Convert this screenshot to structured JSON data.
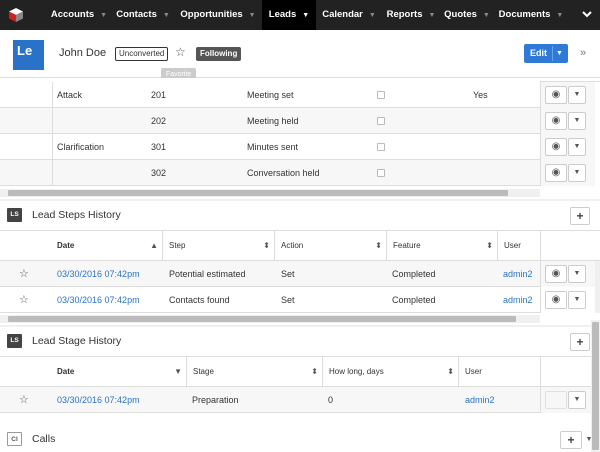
{
  "nav": {
    "items": [
      {
        "label": "Accounts"
      },
      {
        "label": "Contacts"
      },
      {
        "label": "Opportunities"
      },
      {
        "label": "Leads"
      },
      {
        "label": "Calendar"
      },
      {
        "label": "Reports"
      },
      {
        "label": "Quotes"
      },
      {
        "label": "Documents"
      }
    ],
    "active": "Leads",
    "more_icon": "chevron-down-icon"
  },
  "header": {
    "avatar_text": "Le",
    "name": "John Doe",
    "status_badge": "Unconverted",
    "following_badge": "Following",
    "tooltip": "Favorite",
    "edit_label": "Edit"
  },
  "top_table": {
    "rows": [
      {
        "col1": "Attack",
        "code": "201",
        "step": "Meeting set",
        "flag": "Yes"
      },
      {
        "col1": "",
        "code": "202",
        "step": "Meeting held",
        "flag": ""
      },
      {
        "col1": "Clarification",
        "code": "301",
        "step": "Minutes sent",
        "flag": ""
      },
      {
        "col1": "",
        "code": "302",
        "step": "Conversation held",
        "flag": ""
      }
    ]
  },
  "steps_history": {
    "icon": "LS",
    "title": "Lead Steps History",
    "columns": [
      "Date",
      "Step",
      "Action",
      "Feature",
      "User"
    ],
    "rows": [
      {
        "date": "03/30/2016 07:42pm",
        "step": "Potential estimated",
        "action": "Set",
        "feature": "Completed",
        "user": "admin2"
      },
      {
        "date": "03/30/2016 07:42pm",
        "step": "Contacts found",
        "action": "Set",
        "feature": "Completed",
        "user": "admin2"
      }
    ]
  },
  "stage_history": {
    "icon": "LS",
    "title": "Lead Stage History",
    "columns": [
      "Date",
      "Stage",
      "How long, days",
      "User"
    ],
    "rows": [
      {
        "date": "03/30/2016 07:42pm",
        "stage": "Preparation",
        "days": "0",
        "user": "admin2"
      }
    ]
  },
  "calls": {
    "icon": "Cl",
    "title": "Calls"
  },
  "colors": {
    "nav_bg": "#222222",
    "accent": "#2f7ad6",
    "link": "#2a72c8"
  }
}
